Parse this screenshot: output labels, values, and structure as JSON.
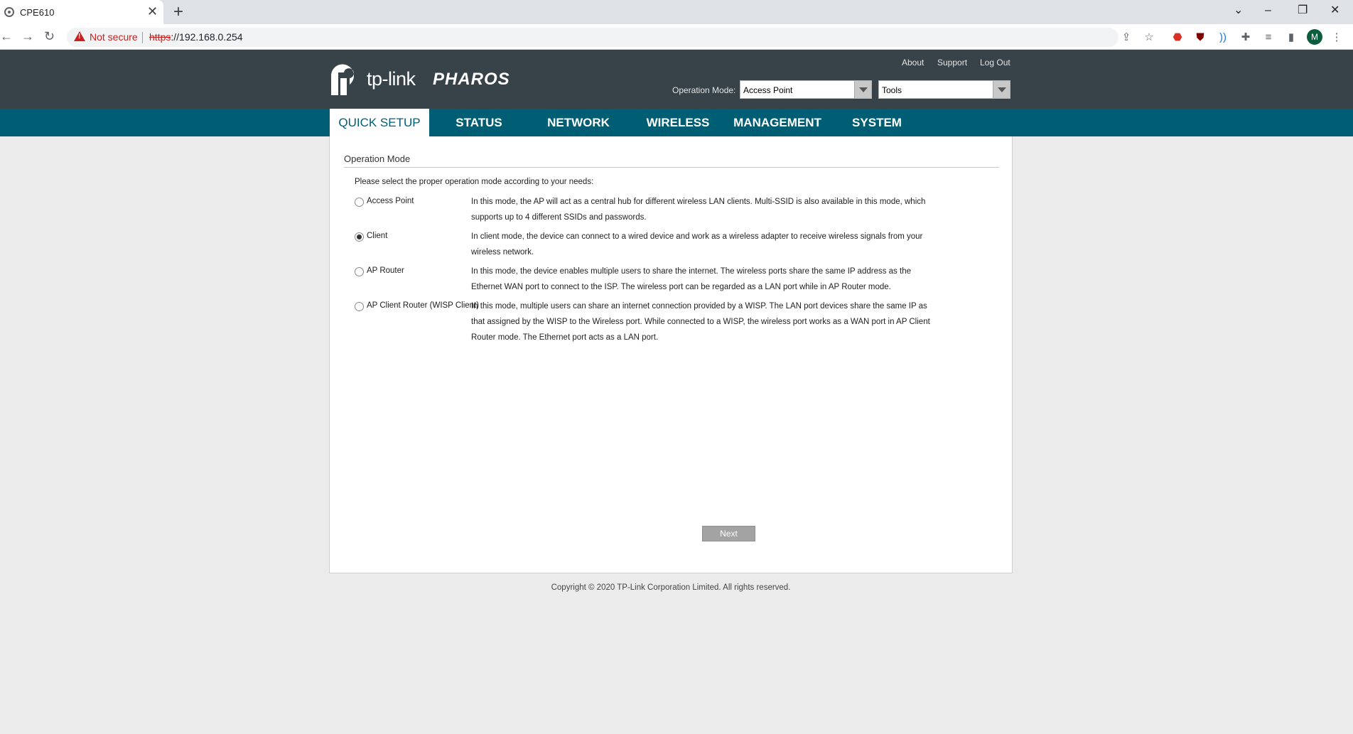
{
  "browser": {
    "tab_title": "CPE610",
    "tab_close": "✕",
    "new_tab": "+",
    "security_label": "Not secure",
    "url_scheme": "https",
    "url_rest": "://192.168.0.254",
    "avatar_initial": "M",
    "warning_color": "#c5221f"
  },
  "header": {
    "logo_word": "tp-link",
    "logo_pharos": "PHAROS",
    "links": {
      "about": "About",
      "support": "Support",
      "logout": "Log Out"
    },
    "opmode_label": "Operation Mode:",
    "opmode_value": "Access Point",
    "tools_value": "Tools",
    "bg_color": "#374349"
  },
  "nav": {
    "items": [
      "QUICK SETUP",
      "STATUS",
      "NETWORK",
      "WIRELESS",
      "MANAGEMENT",
      "SYSTEM"
    ],
    "active": "QUICK SETUP",
    "bar_color": "#005e74"
  },
  "content": {
    "title": "Operation Mode",
    "intro": "Please select the proper operation mode according to your needs:",
    "modes": [
      {
        "label": "Access Point",
        "selected": false,
        "desc": "In this mode, the AP will act as a central hub for different wireless LAN clients. Multi-SSID is also available in this mode, which supports up to 4 different SSIDs and passwords."
      },
      {
        "label": "Client",
        "selected": true,
        "desc": "In client mode, the device can connect to a wired device and work as a wireless adapter to receive wireless signals from your wireless network."
      },
      {
        "label": "AP Router",
        "selected": false,
        "desc": "In this mode, the device enables multiple users to share the internet. The wireless ports share the same IP address as the Ethernet WAN port to connect to the ISP. The wireless port can be regarded as a LAN port while in AP Router mode."
      },
      {
        "label": "AP Client Router (WISP Client)",
        "selected": false,
        "desc": "In this mode, multiple users can share an internet connection provided by a WISP. The LAN port devices share the same IP as that assigned by the WISP to the Wireless port. While connected to a WISP, the wireless port works as a WAN port in AP Client Router mode. The Ethernet port acts as a LAN port."
      }
    ],
    "next_label": "Next"
  },
  "footer": {
    "copyright": "Copyright © 2020 TP-Link Corporation Limited. All rights reserved."
  }
}
